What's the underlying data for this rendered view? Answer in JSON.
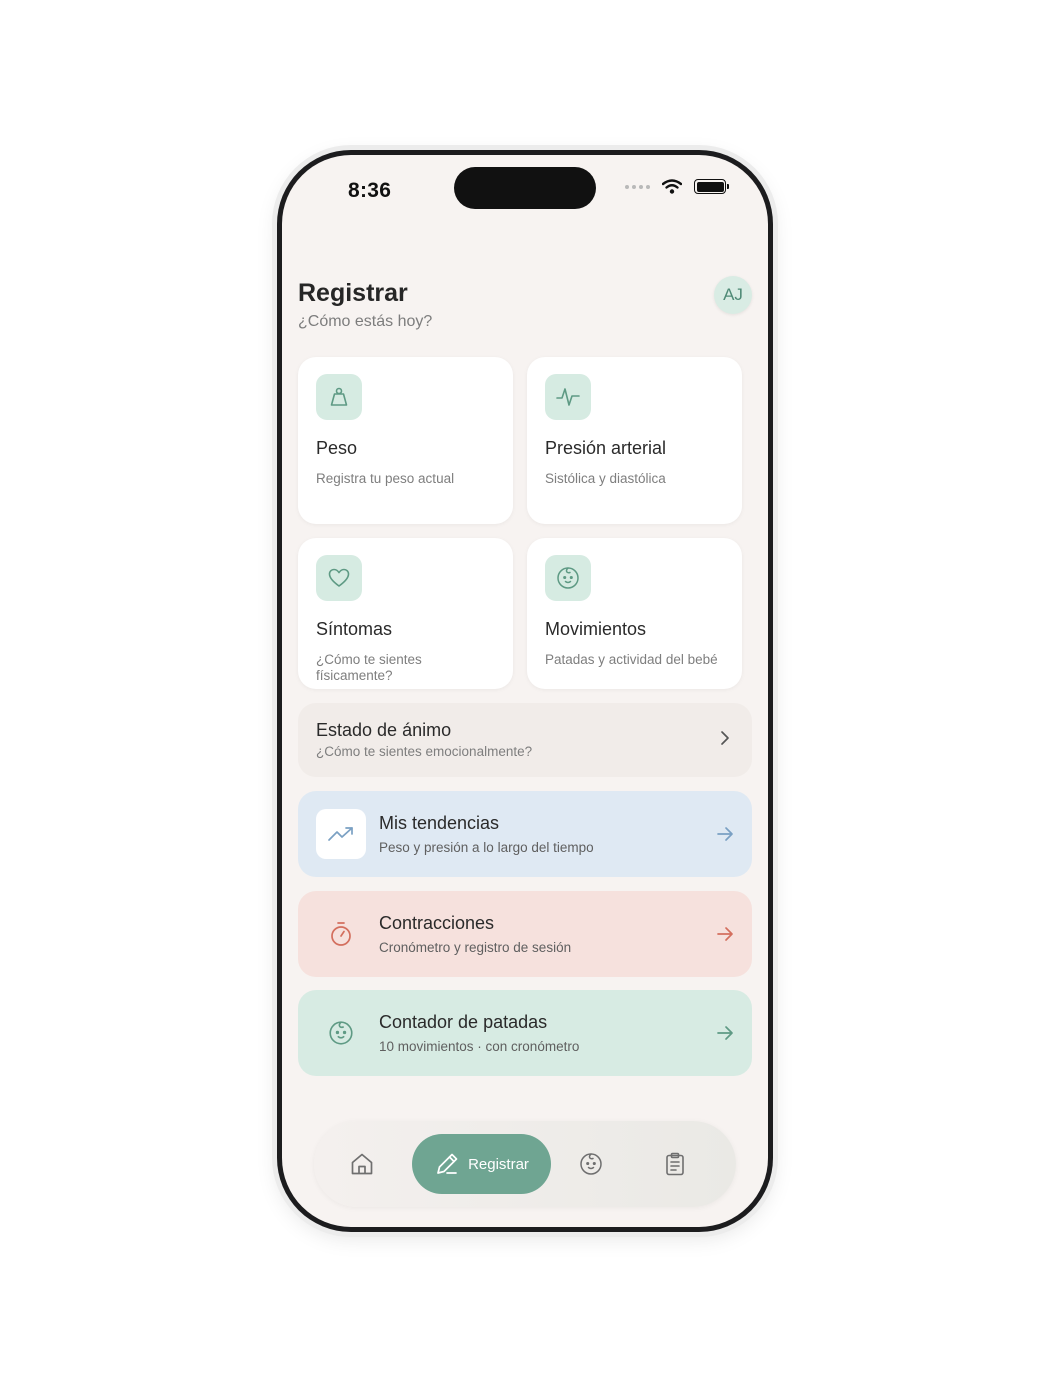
{
  "status_bar": {
    "time": "8:36"
  },
  "header": {
    "title": "Registrar",
    "subtitle": "¿Cómo estás hoy?",
    "avatar_initials": "AJ"
  },
  "cards": [
    {
      "title": "Peso",
      "subtitle": "Registra tu peso actual",
      "icon": "weight-icon"
    },
    {
      "title": "Presión arterial",
      "subtitle": "Sistólica y diastólica",
      "icon": "pulse-icon"
    },
    {
      "title": "Síntomas",
      "subtitle": "¿Cómo te sientes físicamente?",
      "icon": "heart-icon"
    },
    {
      "title": "Movimientos",
      "subtitle": "Patadas y actividad del bebé",
      "icon": "baby-icon"
    }
  ],
  "mood": {
    "title": "Estado de ánimo",
    "subtitle": "¿Cómo te sientes emocionalmente?"
  },
  "rows": [
    {
      "title": "Mis tendencias",
      "subtitle": "Peso y presión a lo largo del tiempo",
      "icon": "trend-up-icon",
      "color": "#7aa0c3"
    },
    {
      "title": "Contracciones",
      "subtitle": "Cronómetro y registro de sesión",
      "icon": "stopwatch-icon",
      "color": "#d36f5e"
    },
    {
      "title": "Contador de patadas",
      "subtitle": "10 movimientos · con cronómetro",
      "icon": "baby-icon",
      "color": "#5e9a84"
    }
  ],
  "tabbar": {
    "active_label": "Registrar",
    "tabs": [
      "home-icon",
      "pencil-icon",
      "baby-icon",
      "clipboard-icon"
    ]
  },
  "colors": {
    "background": "#f7f3f1",
    "accent": "#6fa592",
    "mint": "#d6ebe2",
    "blue": "#dfe9f3",
    "coral": "#f6e1dd"
  }
}
